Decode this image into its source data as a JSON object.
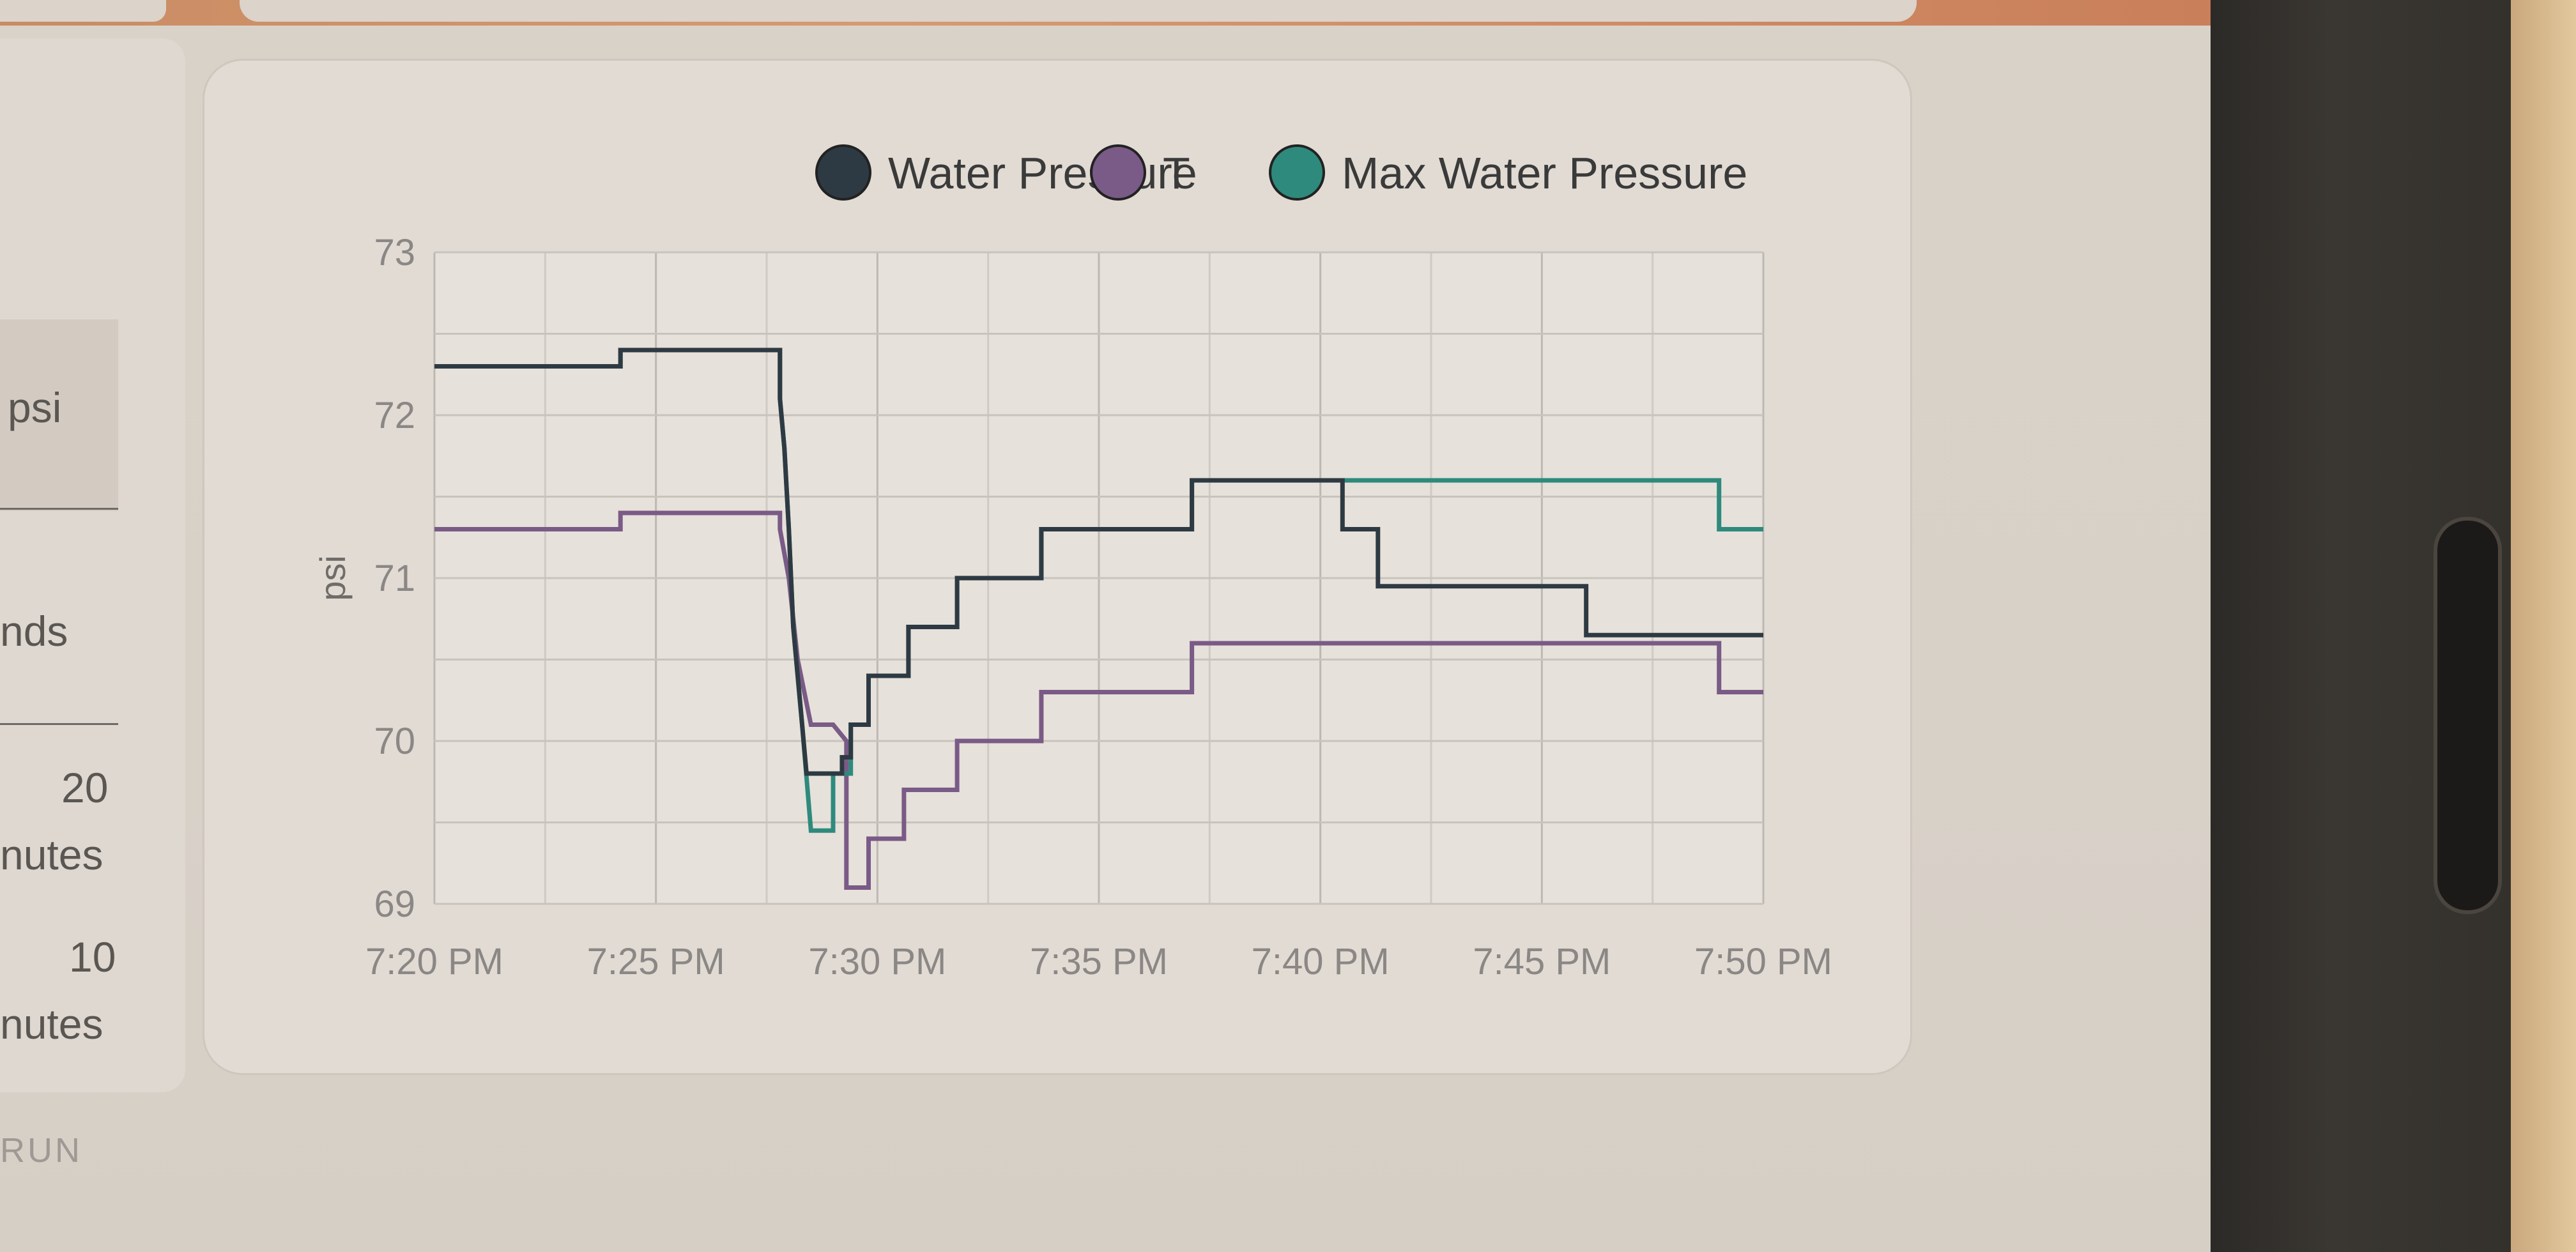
{
  "left_panel": {
    "unit_label": "psi",
    "seconds_label": "nds",
    "option_1_value": "20",
    "option_1_unit": "nutes",
    "option_2_value": "10",
    "option_2_unit": "nutes",
    "run_label": "RUN"
  },
  "chart_data": {
    "type": "line",
    "step": true,
    "title": "",
    "xlabel": "",
    "ylabel": "psi",
    "xlim": [
      0,
      30
    ],
    "ylim": [
      69,
      73
    ],
    "x_ticks": [
      "7:20 PM",
      "7:25 PM",
      "7:30 PM",
      "7:35 PM",
      "7:40 PM",
      "7:45 PM",
      "7:50 PM"
    ],
    "y_ticks": [
      "69",
      "70",
      "71",
      "72",
      "73"
    ],
    "grid": true,
    "legend_position": "top-center",
    "series": [
      {
        "name": "Water Pressure",
        "color": "#2e3a43",
        "points": [
          [
            0,
            72.3
          ],
          [
            4.2,
            72.3
          ],
          [
            4.2,
            72.4
          ],
          [
            7.8,
            72.4
          ],
          [
            7.8,
            72.1
          ],
          [
            7.9,
            71.8
          ],
          [
            8.0,
            71.3
          ],
          [
            8.1,
            70.7
          ],
          [
            8.3,
            70.1
          ],
          [
            8.4,
            69.8
          ],
          [
            9.2,
            69.8
          ],
          [
            9.2,
            69.9
          ],
          [
            9.4,
            69.9
          ],
          [
            9.4,
            70.1
          ],
          [
            9.8,
            70.1
          ],
          [
            9.8,
            70.4
          ],
          [
            10.7,
            70.4
          ],
          [
            10.7,
            70.7
          ],
          [
            11.8,
            70.7
          ],
          [
            11.8,
            71.0
          ],
          [
            13.7,
            71.0
          ],
          [
            13.7,
            71.3
          ],
          [
            17.1,
            71.3
          ],
          [
            17.1,
            71.6
          ],
          [
            20.5,
            71.6
          ],
          [
            20.5,
            71.3
          ],
          [
            21.3,
            71.3
          ],
          [
            21.3,
            70.95
          ],
          [
            26.0,
            70.95
          ],
          [
            26.0,
            70.65
          ],
          [
            30,
            70.65
          ]
        ]
      },
      {
        "name": "T",
        "color": "#7a5a86",
        "points": [
          [
            0,
            71.3
          ],
          [
            4.2,
            71.3
          ],
          [
            4.2,
            71.4
          ],
          [
            7.8,
            71.4
          ],
          [
            7.8,
            71.3
          ],
          [
            8.0,
            71.0
          ],
          [
            8.2,
            70.5
          ],
          [
            8.5,
            70.1
          ],
          [
            9.0,
            70.1
          ],
          [
            9.3,
            70.0
          ],
          [
            9.3,
            69.1
          ],
          [
            9.8,
            69.1
          ],
          [
            9.8,
            69.4
          ],
          [
            10.6,
            69.4
          ],
          [
            10.6,
            69.7
          ],
          [
            11.8,
            69.7
          ],
          [
            11.8,
            70.0
          ],
          [
            13.7,
            70.0
          ],
          [
            13.7,
            70.3
          ],
          [
            17.1,
            70.3
          ],
          [
            17.1,
            70.6
          ],
          [
            29.0,
            70.6
          ],
          [
            29.0,
            70.3
          ],
          [
            30,
            70.3
          ]
        ]
      },
      {
        "name": "Max Water Pressure",
        "color": "#2e8a7c",
        "points": [
          [
            0,
            72.3
          ],
          [
            4.2,
            72.3
          ],
          [
            4.2,
            72.4
          ],
          [
            7.8,
            72.4
          ],
          [
            7.8,
            72.1
          ],
          [
            7.9,
            71.8
          ],
          [
            8.0,
            71.3
          ],
          [
            8.1,
            70.7
          ],
          [
            8.3,
            70.1
          ],
          [
            8.5,
            69.45
          ],
          [
            9.0,
            69.45
          ],
          [
            9.0,
            69.8
          ],
          [
            9.4,
            69.8
          ],
          [
            9.4,
            70.1
          ],
          [
            9.8,
            70.1
          ],
          [
            9.8,
            70.4
          ],
          [
            10.7,
            70.4
          ],
          [
            10.7,
            70.7
          ],
          [
            11.8,
            70.7
          ],
          [
            11.8,
            71.0
          ],
          [
            13.7,
            71.0
          ],
          [
            13.7,
            71.3
          ],
          [
            17.1,
            71.3
          ],
          [
            17.1,
            71.6
          ],
          [
            29.0,
            71.6
          ],
          [
            29.0,
            71.3
          ],
          [
            30,
            71.3
          ]
        ]
      }
    ]
  }
}
